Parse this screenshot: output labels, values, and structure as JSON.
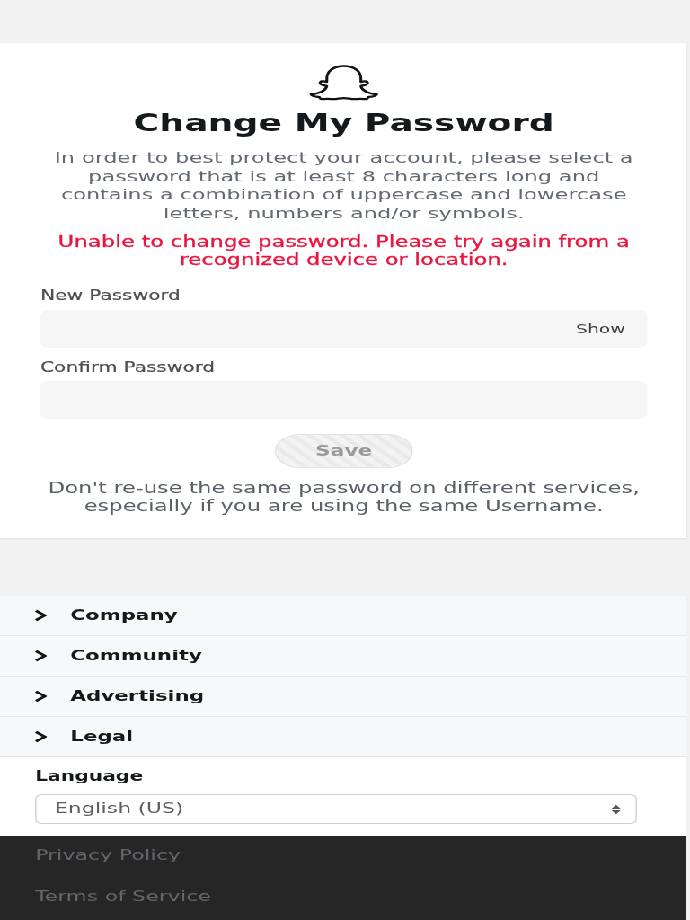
{
  "title": "Change My Password",
  "intro": "In order to best protect your account, please select a password that is at least 8 characters long and contains a combination of uppercase and lowercase letters, numbers and/or symbols.",
  "error": "Unable to change password. Please try again from a recognized device or location.",
  "fields": [
    {
      "label": "New Password",
      "toggle": "Show"
    },
    {
      "label": "Confirm Password"
    }
  ],
  "save_button": {
    "label": "Save",
    "disabled": true
  },
  "note": "Don't re-use the same password on different services, especially if you are using the same Username.",
  "footer_sections": [
    {
      "label": "Company",
      "expanded": false
    },
    {
      "label": "Community",
      "expanded": false
    },
    {
      "label": "Advertising",
      "expanded": false
    },
    {
      "label": "Legal",
      "expanded": false
    }
  ],
  "language": {
    "label": "Language",
    "value": "English (US)"
  },
  "footer_links": [
    "Privacy Policy",
    "Terms of Service"
  ]
}
